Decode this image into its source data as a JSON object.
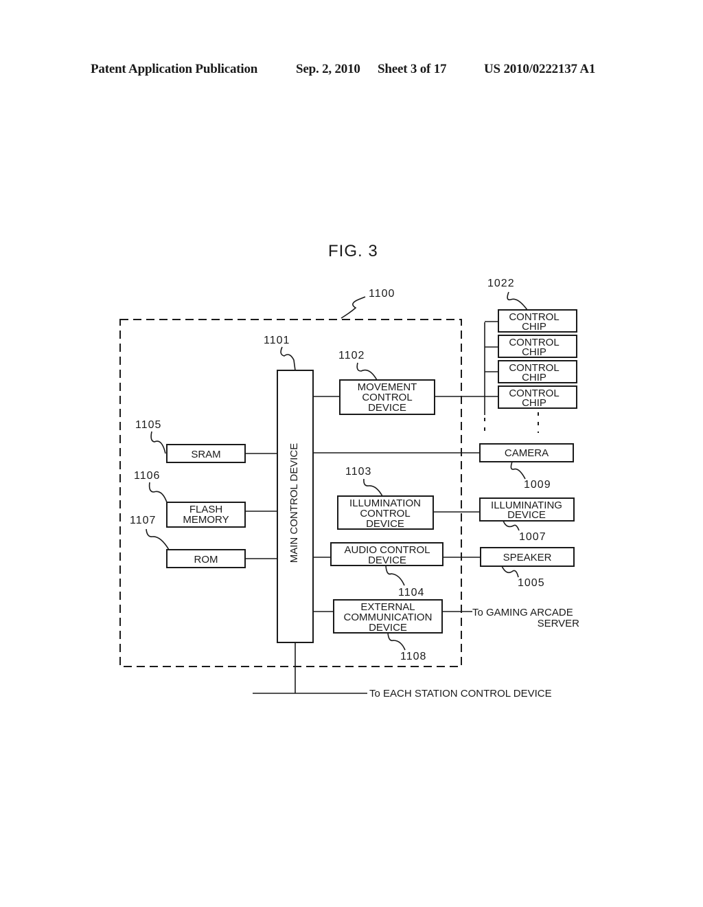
{
  "header": {
    "publication": "Patent Application Publication",
    "date": "Sep. 2, 2010",
    "sheet": "Sheet 3 of 17",
    "number": "US 2010/0222137 A1"
  },
  "figure": {
    "title": "FIG. 3",
    "enclosure_ref": "1100",
    "main": {
      "ref": "1101",
      "label": "MAIN CONTROL DEVICE"
    },
    "memory": [
      {
        "ref": "1105",
        "lines": [
          "SRAM"
        ]
      },
      {
        "ref": "1106",
        "lines": [
          "FLASH",
          "MEMORY"
        ]
      },
      {
        "ref": "1107",
        "lines": [
          "ROM"
        ]
      }
    ],
    "controllers": [
      {
        "ref": "1102",
        "lines": [
          "MOVEMENT",
          "CONTROL",
          "DEVICE"
        ]
      },
      {
        "ref": "1103",
        "lines": [
          "ILLUMINATION",
          "CONTROL",
          "DEVICE"
        ]
      },
      {
        "ref": "1104",
        "lines": [
          "AUDIO CONTROL",
          "DEVICE"
        ]
      },
      {
        "ref": "1108",
        "lines": [
          "EXTERNAL",
          "COMMUNICATION",
          "DEVICE"
        ]
      }
    ],
    "chips": {
      "ref": "1022",
      "items": [
        [
          "CONTROL",
          "CHIP"
        ],
        [
          "CONTROL",
          "CHIP"
        ],
        [
          "CONTROL",
          "CHIP"
        ],
        [
          "CONTROL",
          "CHIP"
        ]
      ]
    },
    "peripherals": [
      {
        "ref": "1009",
        "lines": [
          "CAMERA"
        ]
      },
      {
        "ref": "1007",
        "lines": [
          "ILLUMINATING",
          "DEVICE"
        ]
      },
      {
        "ref": "1005",
        "lines": [
          "SPEAKER"
        ]
      }
    ],
    "external_links": {
      "server": [
        "To GAMING ARCADE",
        "SERVER"
      ],
      "station": "To EACH STATION CONTROL DEVICE"
    }
  }
}
